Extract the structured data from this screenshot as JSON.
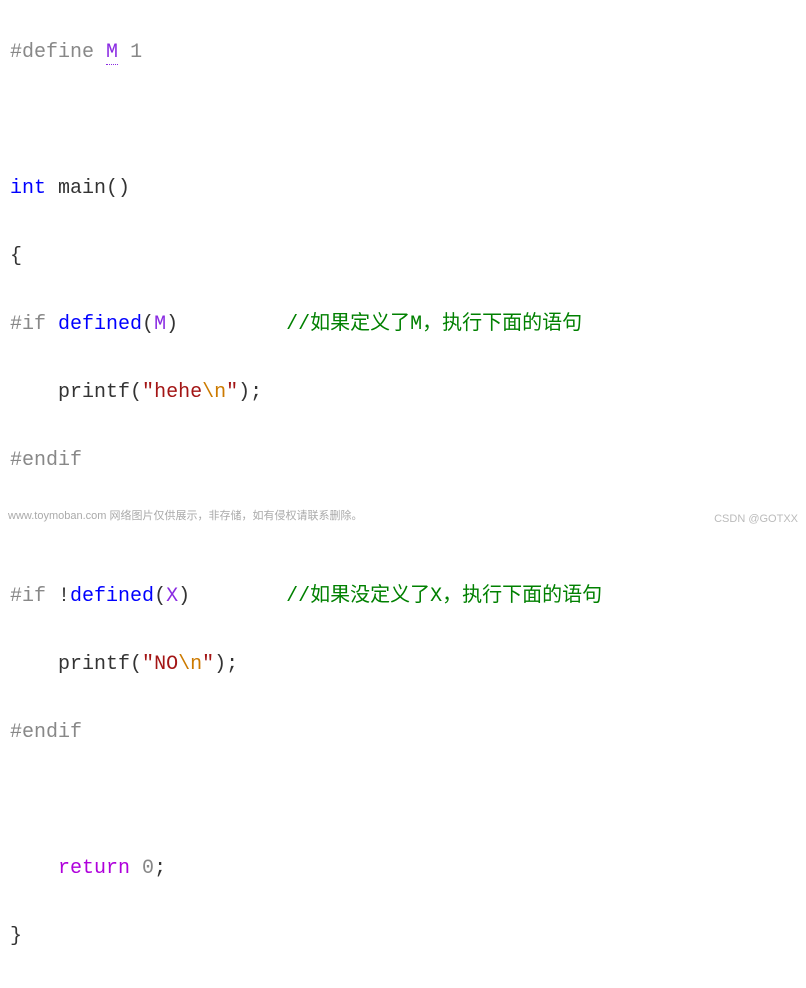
{
  "code": {
    "line1": {
      "hash_define": "#define",
      "macro": "M",
      "value": "1"
    },
    "line3": {
      "int": "int",
      "main": "main",
      "parens": "()"
    },
    "line4": {
      "brace": "{"
    },
    "line5": {
      "hash_if": "#if",
      "defined": "defined",
      "open": "(",
      "arg": "M",
      "close": ")",
      "comment": "//如果定义了M，执行下面的语句"
    },
    "line6": {
      "indent": "    ",
      "printf": "printf",
      "open": "(",
      "quote1": "\"",
      "str": "hehe",
      "esc": "\\n",
      "quote2": "\"",
      "close": ")",
      "semi": ";"
    },
    "line7": {
      "hash_endif": "#endif"
    },
    "line9": {
      "hash_if": "#if",
      "not": "!",
      "defined": "defined",
      "open": "(",
      "arg": "X",
      "close": ")",
      "comment": "//如果没定义了X，执行下面的语句"
    },
    "line10": {
      "indent": "    ",
      "printf": "printf",
      "open": "(",
      "quote1": "\"",
      "str": "NO",
      "esc": "\\n",
      "quote2": "\"",
      "close": ")",
      "semi": ";"
    },
    "line11": {
      "hash_endif": "#endif"
    },
    "line13": {
      "indent": "    ",
      "return": "return",
      "value": "0",
      "semi": ";"
    },
    "line14": {
      "brace": "}"
    }
  },
  "footer": {
    "left": "www.toymoban.com 网络图片仅供展示，非存储，如有侵权请联系删除。",
    "right": "CSDN @GOTXX"
  }
}
